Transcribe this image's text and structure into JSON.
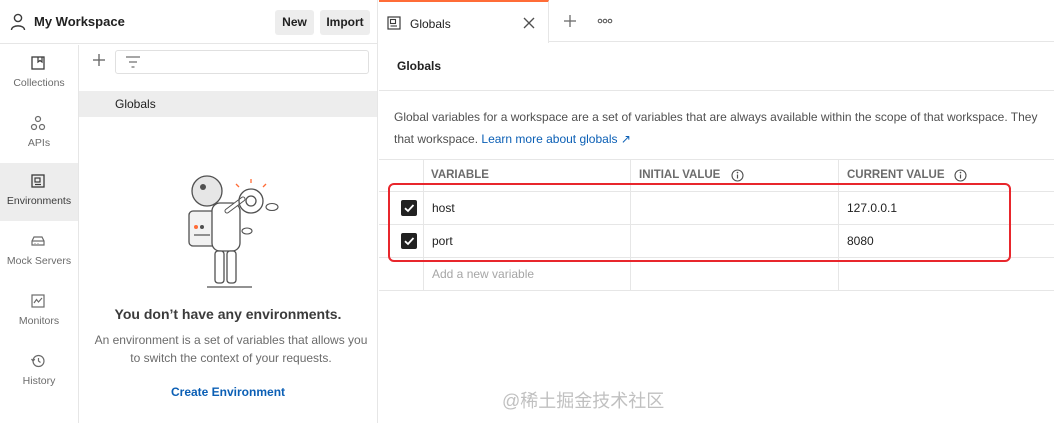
{
  "workspace": {
    "title": "My Workspace",
    "new_label": "New",
    "import_label": "Import"
  },
  "rail": [
    {
      "label": "Collections",
      "icon": "collections-icon"
    },
    {
      "label": "APIs",
      "icon": "apis-icon"
    },
    {
      "label": "Environments",
      "icon": "environments-icon",
      "active": true
    },
    {
      "label": "Mock Servers",
      "icon": "mock-servers-icon"
    },
    {
      "label": "Monitors",
      "icon": "monitors-icon"
    },
    {
      "label": "History",
      "icon": "history-icon"
    }
  ],
  "env_panel": {
    "globals_label": "Globals",
    "empty_title": "You don’t have any environments.",
    "empty_desc": "An environment is a set of variables that allows you to switch the context of your requests.",
    "create_label": "Create Environment"
  },
  "tab": {
    "label": "Globals"
  },
  "page": {
    "title": "Globals",
    "desc_text": "Global variables for a workspace are a set of variables that are always available within the scope of that workspace. They",
    "desc_text2": "that workspace.",
    "learn_more": "Learn more about globals ↗"
  },
  "table": {
    "headers": {
      "variable": "VARIABLE",
      "initial": "INITIAL VALUE",
      "current": "CURRENT VALUE"
    },
    "rows": [
      {
        "checked": true,
        "variable": "host",
        "initial": "",
        "current": "127.0.0.1"
      },
      {
        "checked": true,
        "variable": "port",
        "initial": "",
        "current": "8080"
      }
    ],
    "add_placeholder": "Add a new variable"
  },
  "watermark": "@稀土掘金技术社区",
  "colors": {
    "accent": "#ff6c37",
    "link": "#0b5fb5",
    "highlight": "#e8262c"
  }
}
